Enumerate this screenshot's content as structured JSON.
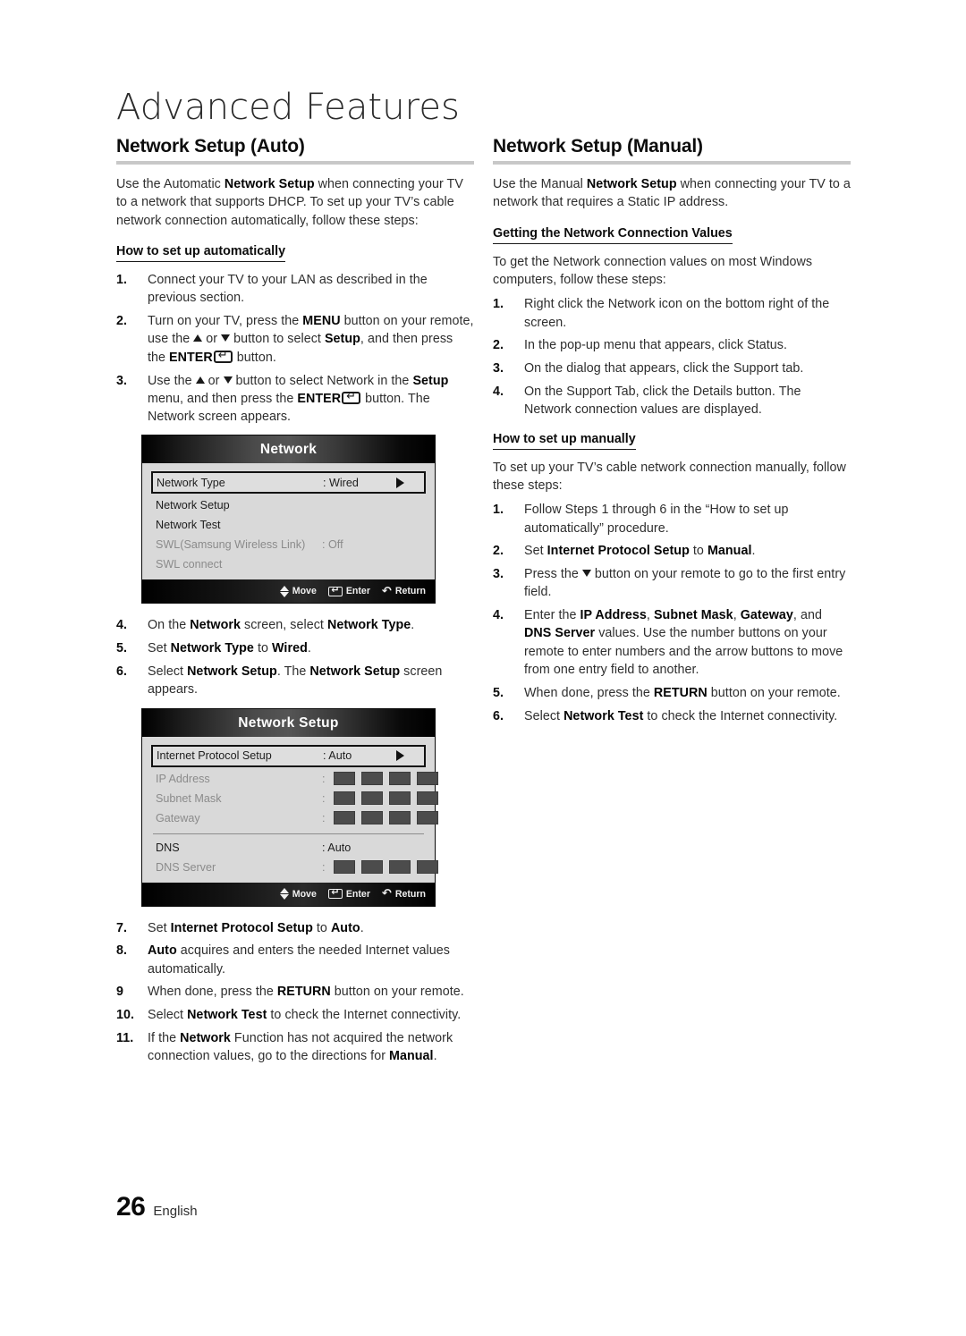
{
  "chapter": {
    "title": "Advanced Features"
  },
  "footer": {
    "page_number": "26",
    "language": "English"
  },
  "left": {
    "heading": "Network Setup (Auto)",
    "intro": "Use the Automatic Network Setup when connecting your TV to a network that supports DHCP. To set up your TV's cable network connection automatically, follow these steps:",
    "intro_bold": "Network Setup",
    "subhead": "How to set up automatically",
    "steps_1_3": [
      {
        "num": "1.",
        "text": "Connect your TV to your LAN as described in the previous section."
      },
      {
        "num": "2.",
        "text": "Turn on your TV, press the MENU button on your remote, use the ▲ or ▼ button to select Setup, and then press the ENTER button."
      },
      {
        "num": "3.",
        "text": "Use the ▲ or ▼ button to select Network in the Setup menu, and then press the ENTER button. The Network screen appears."
      }
    ],
    "steps_4_6": [
      {
        "num": "4.",
        "text": "On the Network screen, select Network Type."
      },
      {
        "num": "5.",
        "text": "Set Network Type to Wired."
      },
      {
        "num": "6.",
        "text": "Select Network Setup. The Network Setup screen appears."
      }
    ],
    "steps_7_11": [
      {
        "num": "7.",
        "text": "Set Internet Protocol Setup to Auto."
      },
      {
        "num": "8.",
        "text": "Auto acquires and enters the needed Internet values automatically."
      },
      {
        "num": "9",
        "text": "When done, press the RETURN button on your remote."
      },
      {
        "num": "10.",
        "text": "Select Network Test to check the Internet connectivity."
      },
      {
        "num": "11.",
        "text": "If the Network Function has not acquired the network connection values, go to the directions for Manual."
      }
    ]
  },
  "right": {
    "heading": "Network Setup (Manual)",
    "intro": "Use the Manual Network Setup when connecting your TV to a network that requires a Static IP address.",
    "subhead_values": "Getting the Network Connection Values",
    "values_intro": "To get the Network connection values on most Windows computers, follow these steps:",
    "values_steps": [
      {
        "num": "1.",
        "text": "Right click the Network icon on the bottom right of the screen."
      },
      {
        "num": "2.",
        "text": "In the pop-up menu that appears, click Status."
      },
      {
        "num": "3.",
        "text": "On the dialog that appears, click the Support tab."
      },
      {
        "num": "4.",
        "text": "On the Support Tab, click the Details button. The Network connection values are displayed."
      }
    ],
    "subhead_manual": "How to set up manually",
    "manual_intro": "To set up your TV's cable network connection manually, follow these steps:",
    "manual_steps": [
      {
        "num": "1.",
        "text": "Follow Steps 1 through 6 in the “How to set up automatically” procedure."
      },
      {
        "num": "2.",
        "text": "Set Internet Protocol Setup to Manual."
      },
      {
        "num": "3.",
        "text": "Press the ▼ button on your remote to go to the first entry field."
      },
      {
        "num": "4.",
        "text": "Enter the IP Address, Subnet Mask, Gateway, and DNS Server values. Use the number buttons on your remote to enter numbers and the arrow buttons to move from one entry field to another."
      },
      {
        "num": "5.",
        "text": "When done, press the RETURN button on your remote."
      },
      {
        "num": "6.",
        "text": "Select Network Test to check the Internet connectivity."
      }
    ]
  },
  "osd_network": {
    "title": "Network",
    "rows": [
      {
        "label": "Network Type",
        "value": ": Wired",
        "selected": true,
        "dim": false,
        "arrow": true
      },
      {
        "label": "Network Setup",
        "value": "",
        "selected": false,
        "dim": false,
        "arrow": false
      },
      {
        "label": "Network Test",
        "value": "",
        "selected": false,
        "dim": false,
        "arrow": false
      },
      {
        "label": "SWL(Samsung Wireless Link)",
        "value": ": Off",
        "selected": false,
        "dim": true,
        "arrow": false
      },
      {
        "label": "SWL connect",
        "value": "",
        "selected": false,
        "dim": true,
        "arrow": false
      }
    ],
    "footer": {
      "move": "Move",
      "enter": "Enter",
      "return": "Return"
    }
  },
  "osd_network_setup": {
    "title": "Network Setup",
    "rows": [
      {
        "label": "Internet Protocol Setup",
        "value": ": Auto"
      },
      {
        "label": "IP Address",
        "value": ":"
      },
      {
        "label": "Subnet Mask",
        "value": ":"
      },
      {
        "label": "Gateway",
        "value": ":"
      },
      {
        "label": "DNS",
        "value": ": Auto"
      },
      {
        "label": "DNS Server",
        "value": ":"
      }
    ],
    "footer": {
      "move": "Move",
      "enter": "Enter",
      "return": "Return"
    }
  }
}
